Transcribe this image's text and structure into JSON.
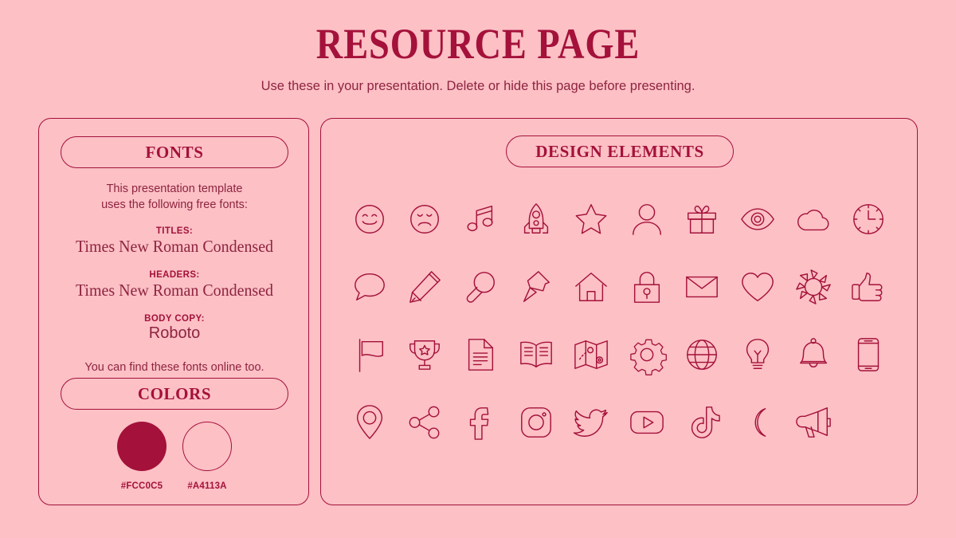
{
  "header": {
    "title": "RESOURCE PAGE",
    "subtitle": "Use these in your presentation. Delete or hide this page before presenting."
  },
  "theme": {
    "background": "#FCC0C5",
    "accent": "#A4113A"
  },
  "fonts_panel": {
    "pill_label": "FONTS",
    "intro_line1": "This presentation template",
    "intro_line2": "uses the following free fonts:",
    "groups": [
      {
        "label": "TITLES:",
        "name": "Times New Roman Condensed",
        "style": "serif"
      },
      {
        "label": "HEADERS:",
        "name": "Times New Roman Condensed",
        "style": "serif"
      },
      {
        "label": "BODY COPY:",
        "name": "Roboto",
        "style": "sans"
      }
    ],
    "outro": "You can find these fonts online too."
  },
  "colors_panel": {
    "pill_label": "COLORS",
    "swatches": [
      {
        "hex": "#FCC0C5",
        "fill": "#A4113A",
        "style": "filled"
      },
      {
        "hex": "#A4113A",
        "fill": "#FCC0C5",
        "style": "outline"
      }
    ]
  },
  "design_panel": {
    "pill_label": "DESIGN ELEMENTS",
    "icons": [
      "smiley-face-icon",
      "sad-face-icon",
      "music-note-icon",
      "rocket-icon",
      "star-icon",
      "person-icon",
      "gift-icon",
      "eye-icon",
      "cloud-icon",
      "clock-icon",
      "speech-bubble-icon",
      "pencil-icon",
      "magnifying-glass-icon",
      "push-pin-icon",
      "house-icon",
      "lock-icon",
      "envelope-icon",
      "heart-icon",
      "sun-icon",
      "thumbs-up-icon",
      "flag-icon",
      "trophy-icon",
      "document-icon",
      "open-book-icon",
      "folded-map-icon",
      "gear-icon",
      "globe-icon",
      "lightbulb-icon",
      "bell-icon",
      "smartphone-icon",
      "location-pin-icon",
      "share-icon",
      "facebook-icon",
      "instagram-icon",
      "twitter-icon",
      "youtube-icon",
      "tiktok-icon",
      "moon-icon",
      "megaphone-icon"
    ]
  }
}
